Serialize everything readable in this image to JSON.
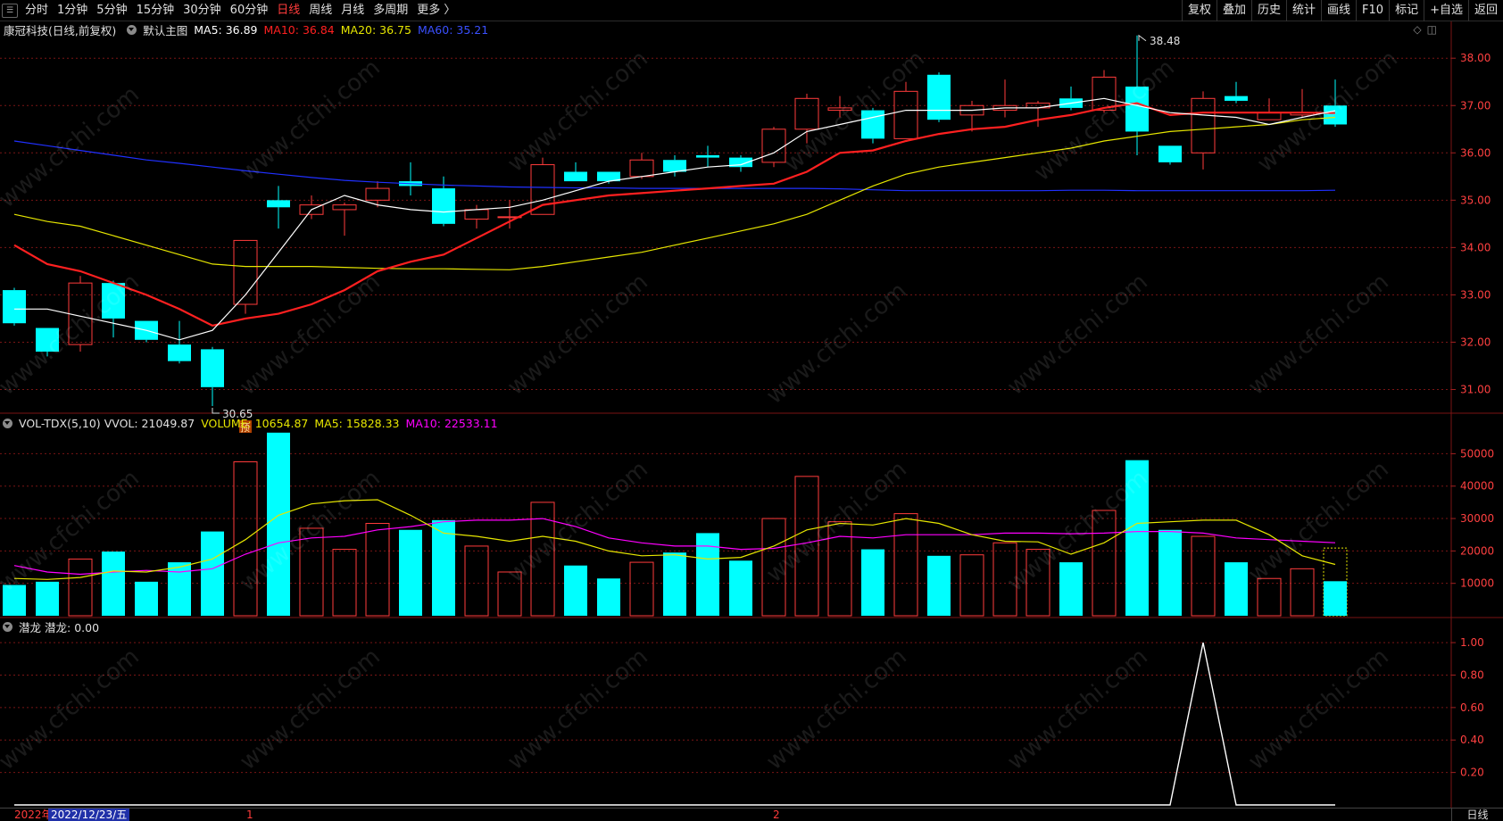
{
  "toolbar": {
    "periods": [
      "分时",
      "1分钟",
      "5分钟",
      "15分钟",
      "30分钟",
      "60分钟",
      "日线",
      "周线",
      "月线",
      "多周期",
      "更多 〉"
    ],
    "active_index": 6,
    "right_buttons": [
      "复权",
      "叠加",
      "历史",
      "统计",
      "画线",
      "F10",
      "标记",
      "+自选",
      "返回"
    ]
  },
  "main_info": {
    "stock": "康冠科技(日线,前复权)",
    "template": "默认主图",
    "ma5": "MA5: 36.89",
    "ma10": "MA10: 36.84",
    "ma20": "MA20: 36.75",
    "ma60": "MA60: 35.21"
  },
  "vol_info": {
    "name": "VOL-TDX(5,10)",
    "vvol": "VVOL: 21049.87",
    "volume": "VOLUME: 10654.87",
    "ma5": "MA5: 15828.33",
    "ma10": "MA10: 22533.11"
  },
  "ql_info": {
    "name": "潜龙",
    "value": "潜龙: 0.00"
  },
  "annotations": {
    "high": "38.48",
    "low": "30.65",
    "pre_tag": "预"
  },
  "status": {
    "year": "2022年",
    "date": "2022/12/23/五",
    "month1": "1",
    "month2": "2",
    "period": "日线"
  },
  "watermark": "www.cfchi.com",
  "colors": {
    "up": "#ff3b3b",
    "down": "#00ffff",
    "ma5": "#ffffff",
    "ma10": "#ff2020",
    "ma20": "#e6e600",
    "ma60": "#2030ff",
    "vol_ma10": "#ff00ff",
    "grid": "#7a1515"
  },
  "chart_data": [
    {
      "type": "candlestick",
      "title": "康冠科技(日线,前复权)",
      "ylim": [
        30.5,
        38.4
      ],
      "y_ticks": [
        "31.00",
        "32.00",
        "33.00",
        "34.00",
        "35.00",
        "36.00",
        "37.00",
        "38.00"
      ],
      "candles": [
        {
          "o": 33.1,
          "h": 33.15,
          "l": 32.35,
          "c": 32.4
        },
        {
          "o": 32.3,
          "h": 32.3,
          "l": 31.7,
          "c": 31.8
        },
        {
          "o": 31.95,
          "h": 33.4,
          "l": 31.8,
          "c": 33.25
        },
        {
          "o": 33.25,
          "h": 33.3,
          "l": 32.1,
          "c": 32.5
        },
        {
          "o": 32.45,
          "h": 32.45,
          "l": 32.0,
          "c": 32.05
        },
        {
          "o": 31.95,
          "h": 32.45,
          "l": 31.55,
          "c": 31.6
        },
        {
          "o": 31.85,
          "h": 31.9,
          "l": 30.65,
          "c": 31.05
        },
        {
          "o": 32.8,
          "h": 34.15,
          "l": 32.6,
          "c": 34.15
        },
        {
          "o": 35.0,
          "h": 35.3,
          "l": 34.4,
          "c": 34.85
        },
        {
          "o": 34.7,
          "h": 35.1,
          "l": 34.6,
          "c": 34.9
        },
        {
          "o": 34.8,
          "h": 34.95,
          "l": 34.25,
          "c": 34.9
        },
        {
          "o": 35.0,
          "h": 35.4,
          "l": 34.85,
          "c": 35.25
        },
        {
          "o": 35.4,
          "h": 35.8,
          "l": 35.1,
          "c": 35.3
        },
        {
          "o": 35.25,
          "h": 35.5,
          "l": 34.45,
          "c": 34.5
        },
        {
          "o": 34.6,
          "h": 34.9,
          "l": 34.4,
          "c": 34.8
        },
        {
          "o": 34.65,
          "h": 35.0,
          "l": 34.4,
          "c": 34.65
        },
        {
          "o": 34.7,
          "h": 35.9,
          "l": 34.7,
          "c": 35.75
        },
        {
          "o": 35.6,
          "h": 35.8,
          "l": 35.4,
          "c": 35.4
        },
        {
          "o": 35.6,
          "h": 35.6,
          "l": 35.35,
          "c": 35.4
        },
        {
          "o": 35.5,
          "h": 36.0,
          "l": 35.45,
          "c": 35.85
        },
        {
          "o": 35.85,
          "h": 35.95,
          "l": 35.5,
          "c": 35.6
        },
        {
          "o": 35.95,
          "h": 36.15,
          "l": 35.7,
          "c": 35.9
        },
        {
          "o": 35.9,
          "h": 35.95,
          "l": 35.6,
          "c": 35.7
        },
        {
          "o": 35.8,
          "h": 36.55,
          "l": 35.7,
          "c": 36.5
        },
        {
          "o": 36.5,
          "h": 37.25,
          "l": 36.2,
          "c": 37.15
        },
        {
          "o": 36.9,
          "h": 37.2,
          "l": 36.75,
          "c": 36.95
        },
        {
          "o": 36.9,
          "h": 36.95,
          "l": 36.2,
          "c": 36.3
        },
        {
          "o": 36.3,
          "h": 37.5,
          "l": 36.3,
          "c": 37.3
        },
        {
          "o": 37.65,
          "h": 37.7,
          "l": 36.65,
          "c": 36.7
        },
        {
          "o": 36.8,
          "h": 37.1,
          "l": 36.45,
          "c": 37.0
        },
        {
          "o": 36.9,
          "h": 37.55,
          "l": 36.75,
          "c": 37.0
        },
        {
          "o": 36.95,
          "h": 37.1,
          "l": 36.55,
          "c": 37.05
        },
        {
          "o": 37.15,
          "h": 37.4,
          "l": 36.9,
          "c": 36.95
        },
        {
          "o": 36.9,
          "h": 37.75,
          "l": 36.85,
          "c": 37.6
        },
        {
          "o": 37.4,
          "h": 38.48,
          "l": 35.95,
          "c": 36.45
        },
        {
          "o": 36.15,
          "h": 36.15,
          "l": 35.75,
          "c": 35.8
        },
        {
          "o": 36.0,
          "h": 37.3,
          "l": 35.65,
          "c": 37.15
        },
        {
          "o": 37.2,
          "h": 37.5,
          "l": 37.05,
          "c": 37.1
        },
        {
          "o": 36.7,
          "h": 37.15,
          "l": 36.7,
          "c": 36.85
        },
        {
          "o": 36.8,
          "h": 37.35,
          "l": 36.75,
          "c": 36.85
        },
        {
          "o": 37.0,
          "h": 37.55,
          "l": 36.55,
          "c": 36.6
        }
      ],
      "series": [
        {
          "name": "MA5",
          "values": [
            32.7,
            32.7,
            32.55,
            32.4,
            32.25,
            32.05,
            32.25,
            33.0,
            33.9,
            34.8,
            35.1,
            34.9,
            34.8,
            34.75,
            34.8,
            34.85,
            35.0,
            35.2,
            35.4,
            35.5,
            35.6,
            35.7,
            35.75,
            36.0,
            36.45,
            36.6,
            36.75,
            36.9,
            36.9,
            36.9,
            36.95,
            36.95,
            37.05,
            37.15,
            37.0,
            36.85,
            36.8,
            36.75,
            36.6,
            36.75,
            36.89
          ]
        },
        {
          "name": "MA10",
          "values": [
            34.05,
            33.65,
            33.5,
            33.25,
            33.0,
            32.7,
            32.35,
            32.5,
            32.6,
            32.8,
            33.1,
            33.5,
            33.7,
            33.85,
            34.2,
            34.55,
            34.9,
            35.0,
            35.1,
            35.15,
            35.2,
            35.25,
            35.3,
            35.35,
            35.6,
            36.0,
            36.05,
            36.25,
            36.4,
            36.5,
            36.55,
            36.7,
            36.8,
            36.95,
            37.05,
            36.8,
            36.85,
            36.85,
            36.85,
            36.85,
            36.84
          ]
        },
        {
          "name": "MA20",
          "values": [
            34.7,
            34.55,
            34.45,
            34.25,
            34.05,
            33.85,
            33.65,
            33.6,
            33.6,
            33.6,
            33.58,
            33.56,
            33.55,
            33.55,
            33.54,
            33.53,
            33.6,
            33.7,
            33.8,
            33.9,
            34.05,
            34.2,
            34.35,
            34.5,
            34.7,
            35.0,
            35.3,
            35.55,
            35.7,
            35.8,
            35.9,
            36.0,
            36.1,
            36.25,
            36.35,
            36.45,
            36.5,
            36.55,
            36.6,
            36.7,
            36.75
          ]
        },
        {
          "name": "MA60",
          "values": [
            36.25,
            36.15,
            36.05,
            35.95,
            35.85,
            35.78,
            35.7,
            35.62,
            35.55,
            35.48,
            35.42,
            35.38,
            35.35,
            35.32,
            35.3,
            35.28,
            35.27,
            35.26,
            35.26,
            35.25,
            35.25,
            35.25,
            35.25,
            35.25,
            35.25,
            35.24,
            35.22,
            35.2,
            35.2,
            35.2,
            35.2,
            35.2,
            35.21,
            35.21,
            35.2,
            35.2,
            35.2,
            35.2,
            35.2,
            35.2,
            35.21
          ]
        }
      ]
    },
    {
      "type": "bar",
      "title": "VOL-TDX(5,10)",
      "ylim": [
        0,
        57000
      ],
      "y_ticks": [
        "10000",
        "20000",
        "30000",
        "40000",
        "50000"
      ],
      "volumes": [
        9500,
        10500,
        17500,
        19800,
        10500,
        16500,
        26000,
        47500,
        56500,
        27000,
        20500,
        28500,
        26500,
        29500,
        21500,
        13500,
        35000,
        15500,
        11500,
        16500,
        19500,
        25500,
        17000,
        30000,
        43000,
        29000,
        20500,
        31500,
        18500,
        18800,
        22500,
        20500,
        16500,
        32500,
        48000,
        26500,
        24500,
        16500,
        11500,
        14500,
        10654.87
      ],
      "series": [
        {
          "name": "MA5",
          "values": [
            11500,
            11200,
            11800,
            13800,
            13500,
            15000,
            17500,
            23500,
            31000,
            34500,
            35500,
            35800,
            31000,
            25500,
            24500,
            23000,
            24500,
            23000,
            20000,
            18500,
            18800,
            17500,
            18000,
            21500,
            26500,
            28500,
            28000,
            30000,
            28500,
            25000,
            23000,
            22800,
            19000,
            22500,
            28500,
            29000,
            29500,
            29500,
            25000,
            18500,
            15828.33
          ]
        },
        {
          "name": "MA10",
          "values": [
            15500,
            13500,
            12800,
            13500,
            14000,
            13500,
            14500,
            19000,
            22500,
            24000,
            24500,
            26500,
            27500,
            29000,
            29500,
            29500,
            30000,
            27500,
            24000,
            22500,
            21500,
            21500,
            20500,
            20800,
            22500,
            24500,
            24000,
            25000,
            25000,
            25000,
            25500,
            25500,
            25300,
            25500,
            26000,
            26000,
            25500,
            24000,
            23500,
            23000,
            22533.11
          ]
        }
      ]
    },
    {
      "type": "line",
      "title": "潜龙",
      "ylim": [
        0,
        1.05
      ],
      "y_ticks": [
        "0.20",
        "0.40",
        "0.60",
        "0.80",
        "1.00"
      ],
      "series": [
        {
          "name": "潜龙",
          "values": [
            0,
            0,
            0,
            0,
            0,
            0,
            0,
            0,
            0,
            0,
            0,
            0,
            0,
            0,
            0,
            0,
            0,
            0,
            0,
            0,
            0,
            0,
            0,
            0,
            0,
            0,
            0,
            0,
            0,
            0,
            0,
            0,
            0,
            0,
            0,
            0,
            1.0,
            0,
            0,
            0,
            0
          ]
        }
      ]
    }
  ]
}
